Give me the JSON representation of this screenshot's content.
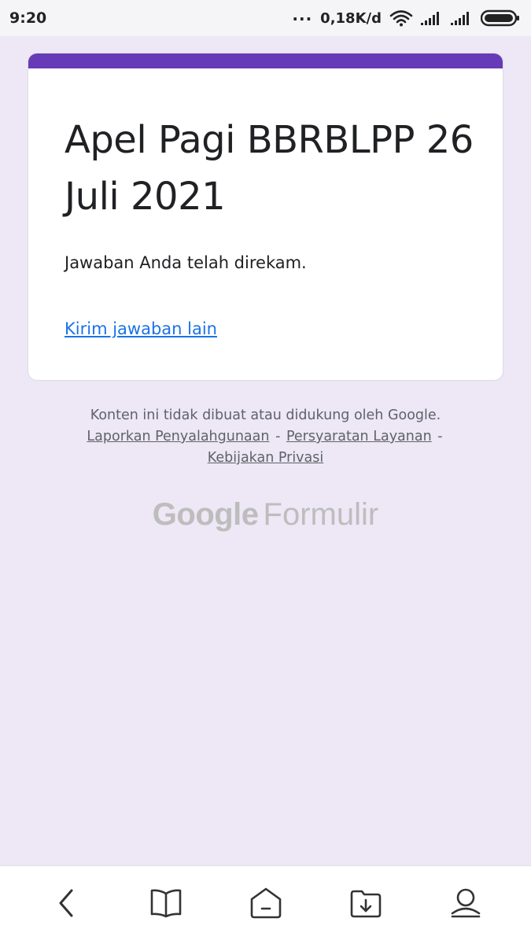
{
  "status_bar": {
    "time": "9:20",
    "dots": "...",
    "network_speed": "0,18K/d",
    "icons": [
      "wifi-icon",
      "signal-icon",
      "signal-icon",
      "battery-icon"
    ]
  },
  "form": {
    "title": "Apel Pagi BBRBLPP 26 Juli 2021",
    "confirmation_message": "Jawaban Anda telah direkam.",
    "another_response_link": "Kirim jawaban lain",
    "accent_color": "#673ab7"
  },
  "footer": {
    "disclaimer": "Konten ini tidak dibuat atau didukung oleh Google.",
    "links": {
      "report_abuse": "Laporkan Penyalahgunaan",
      "terms": "Persyaratan Layanan",
      "privacy": "Kebijakan Privasi"
    },
    "separator": "-",
    "brand_google": "Google",
    "brand_product": "Formulir"
  },
  "bottom_nav": {
    "items": [
      "back-icon",
      "bookmarks-icon",
      "home-icon",
      "downloads-icon",
      "profile-icon"
    ]
  },
  "colors": {
    "background": "#ede7f6",
    "link": "#1a73e8",
    "text": "#202124"
  }
}
